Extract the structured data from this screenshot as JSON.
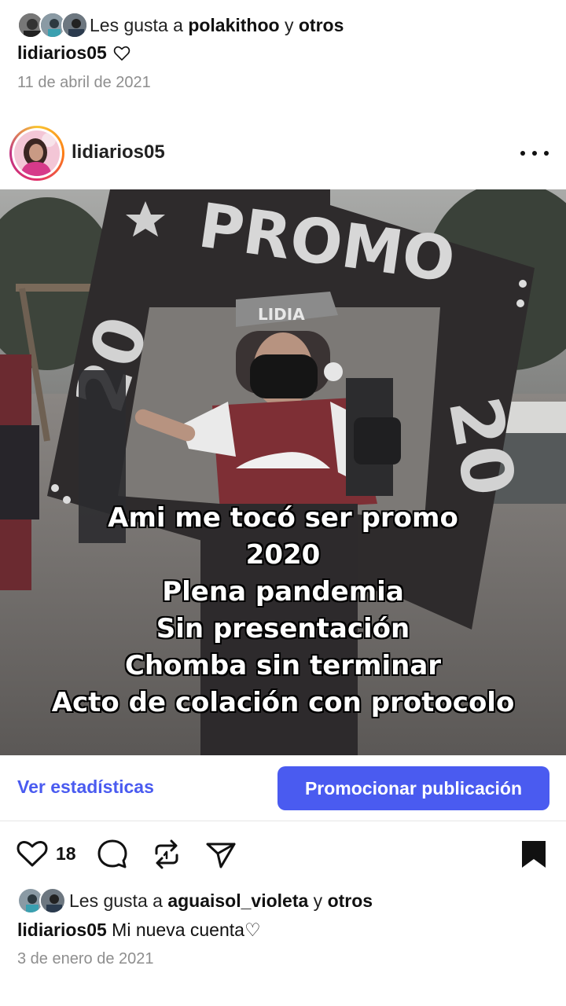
{
  "previous_post": {
    "likes_prefix": "Les gusta a ",
    "likes_user": "polakithoo",
    "likes_connector": " y ",
    "likes_others": "otros",
    "caption_user": "lidiarios05",
    "date": "11 de abril de 2021"
  },
  "post": {
    "username": "lidiarios05",
    "more_icon": "ellipsis-icon",
    "image_text": {
      "sign_word": "PROMO",
      "sign_digit_1": "20",
      "sign_digit_2": "20",
      "cap_text": "LIDIA"
    },
    "overlay_lines": [
      "Ami me tocó ser promo",
      "2020",
      "Plena pandemia",
      "Sin presentación",
      "Chomba sin terminar",
      "Acto de colación con protocolo"
    ],
    "stats_label": "Ver estadísticas",
    "promote_label": "Promocionar publicación",
    "like_count": "18",
    "likes_prefix": "Les gusta a ",
    "likes_user": "aguaisol_violeta",
    "likes_connector": " y ",
    "likes_others": "otros",
    "caption_user": "lidiarios05",
    "caption_text": " Mi nueva cuenta♡",
    "date": "3 de enero de 2021"
  },
  "colors": {
    "accent": "#4a5bf0",
    "date_gray": "#8e8e8e"
  },
  "icons": [
    "heart-icon",
    "comment-icon",
    "repost-icon",
    "share-icon",
    "bookmark-icon"
  ]
}
